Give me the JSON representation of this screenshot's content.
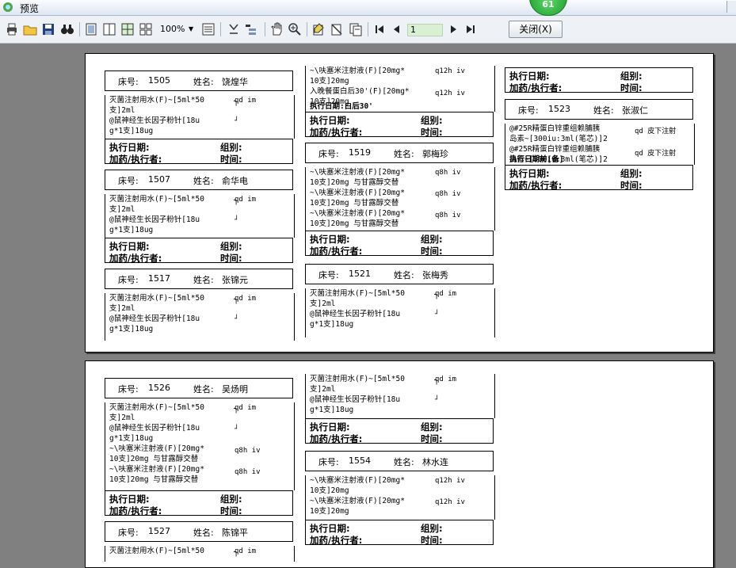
{
  "window": {
    "title": "预览",
    "badge": "61"
  },
  "toolbar": {
    "zoom": "100%",
    "page": "1",
    "close_label": "关闭(X)"
  },
  "labels": {
    "bed": "床号:",
    "name": "姓名:",
    "exec_date": "执行日期:",
    "group": "组别:",
    "dispenser": "加药/执行者:",
    "time": "时间:"
  },
  "page1": {
    "col1": [
      {
        "bed": "1505",
        "name": "饶煌华",
        "orders": [
          "灭菌注射用水(F)~[5ml*50",
          "支]2ml",
          "@鼠神经生长因子粉针[18u",
          "g*1支]18ug"
        ],
        "freqs": [
          "qd im",
          "┘"
        ]
      },
      {
        "bed": "1507",
        "name": "俞华电",
        "orders": [
          "灭菌注射用水(F)~[5ml*50",
          "支]2ml",
          "@鼠神经生长因子粉针[18u",
          "g*1支]18ug"
        ],
        "freqs": [
          "qd im",
          "┘"
        ]
      },
      {
        "bed": "1517",
        "name": "张锦元",
        "orders": [
          "灭菌注射用水(F)~[5ml*50",
          "支]2ml",
          "@鼠神经生长因子粉针[18u",
          "g*1支]18ug"
        ],
        "freqs": [
          "qd im",
          "┘"
        ]
      }
    ],
    "col2": [
      {
        "orders": [
          "~\\呋塞米注射液(F)[20mg*",
          "10支]20mg",
          "入晚餐蛋白后30'(F)[20mg*",
          "10支]20mg"
        ],
        "freqs": [
          "q12h iv",
          "q12h iv"
        ],
        "overlap": "执行日期:白后30'"
      },
      {
        "bed": "1519",
        "name": "郭梅珍",
        "orders": [
          "~\\呋塞米注射液(F)[20mg*",
          "10支]20mg 与甘露醇交替",
          "~\\呋塞米注射液(F)[20mg*",
          "10支]20mg 与甘露醇交替",
          "~\\呋塞米注射液(F)[20mg*",
          "10支]20mg 与甘露醇交替"
        ],
        "freqs": [
          "q8h iv",
          "q8h iv",
          "q8h iv"
        ]
      },
      {
        "bed": "1521",
        "name": "张梅秀",
        "orders": [
          "灭菌注射用水(F)~[5ml*50",
          "支]2ml",
          "@鼠神经生长因子粉针[18u",
          "g*1支]18ug"
        ],
        "freqs": [
          "qd im",
          "┘"
        ]
      }
    ],
    "col3": [
      {
        "bed": "1523",
        "name": "张淑仁",
        "orders": [
          "@#25R精蛋白锌重组赖脯胰",
          "岛素~[300iu:3ml(笔芯)]2",
          "@#25R精蛋白锌重组赖脯胰",
          "岛素~[300iu:3ml(笔芯)]2"
        ],
        "freqs": [
          "qd 皮下注射",
          "qd 皮下注射"
        ],
        "overlap": "执行日期前[备]"
      }
    ]
  },
  "page2": {
    "col1": [
      {
        "bed": "1526",
        "name": "吴炀明",
        "orders": [
          "灭菌注射用水(F)~[5ml*50",
          "支]2ml",
          "@鼠神经生长因子粉针[18u",
          "g*1支]18ug",
          "~\\呋塞米注射液(F)[20mg*",
          "10支]20mg 与甘露醇交替",
          "~\\呋塞米注射液(F)[20mg*",
          "10支]20mg 与甘露醇交替"
        ],
        "freqs": [
          "qd im",
          "┘",
          "q8h iv",
          "q8h iv"
        ]
      },
      {
        "bed": "1527",
        "name": "陈锦平",
        "orders": [
          "灭菌注射用水(F)~[5ml*50"
        ],
        "freqs": [
          "qd im"
        ]
      }
    ],
    "col2": [
      {
        "orders": [
          "灭菌注射用水(F)~[5ml*50",
          "支]2ml",
          "@鼠神经生长因子粉针[18u",
          "g*1支]18ug"
        ],
        "freqs": [
          "qd im",
          "┘"
        ]
      },
      {
        "bed": "1554",
        "name": "林水连",
        "orders": [
          "~\\呋塞米注射液(F)[20mg*",
          "10支]20mg",
          "~\\呋塞米注射液(F)[20mg*",
          "10支]20mg"
        ],
        "freqs": [
          "q12h iv",
          "q12h iv"
        ]
      }
    ]
  }
}
